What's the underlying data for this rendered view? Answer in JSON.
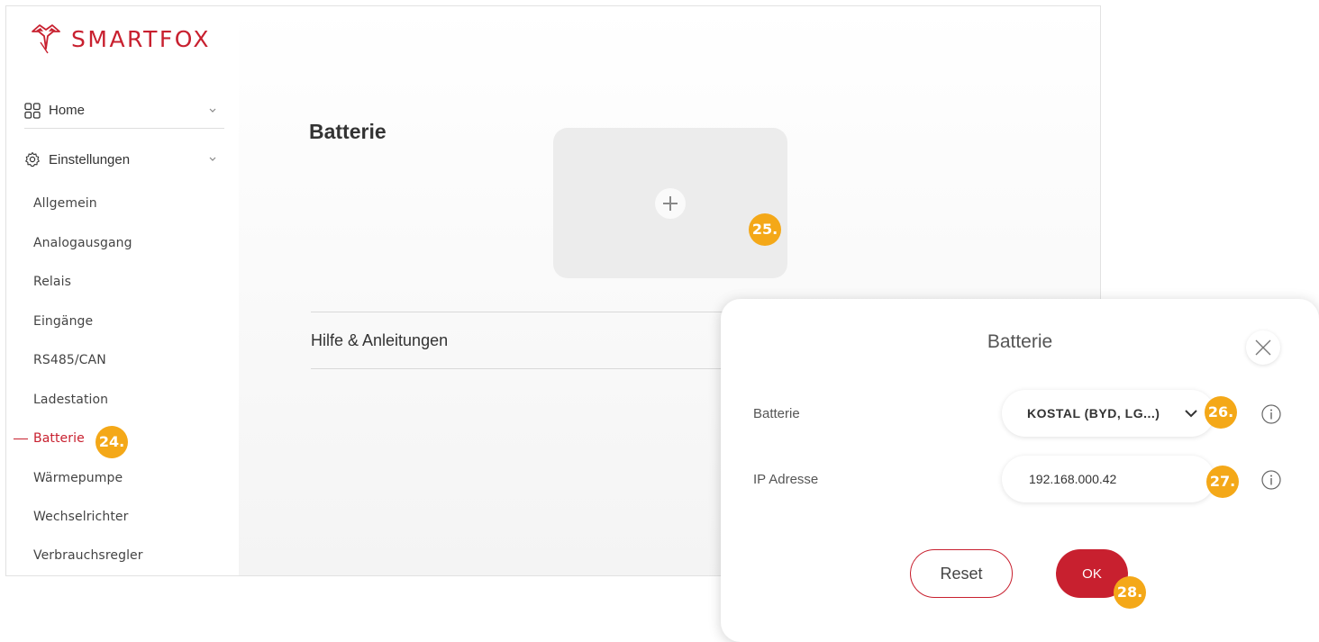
{
  "brand": {
    "name": "SMARTFOX",
    "logo_icon": "fox-icon",
    "accent_color": "#c8202f",
    "marker_color": "#f4a818"
  },
  "sidebar": {
    "home": {
      "label": "Home",
      "icon": "grid-icon"
    },
    "settings": {
      "label": "Einstellungen",
      "icon": "gear-icon"
    },
    "items": [
      {
        "label": "Allgemein"
      },
      {
        "label": "Analogausgang"
      },
      {
        "label": "Relais"
      },
      {
        "label": "Eingänge"
      },
      {
        "label": "RS485/CAN"
      },
      {
        "label": "Ladestation"
      },
      {
        "label": "Batterie",
        "active": true
      },
      {
        "label": "Wärmepumpe"
      },
      {
        "label": "Wechselrichter"
      },
      {
        "label": "Verbrauchsregler"
      }
    ]
  },
  "main": {
    "title": "Batterie",
    "add_card_icon": "plus-icon",
    "help_label": "Hilfe & Anleitungen"
  },
  "modal": {
    "title": "Batterie",
    "close_icon": "close-icon",
    "battery_label": "Batterie",
    "battery_value": "KOSTAL (BYD, LG...)",
    "ip_label": "IP Adresse",
    "ip_value": "192.168.000.42",
    "reset_label": "Reset",
    "ok_label": "OK"
  },
  "markers": [
    "24.",
    "25.",
    "26.",
    "27.",
    "28."
  ]
}
